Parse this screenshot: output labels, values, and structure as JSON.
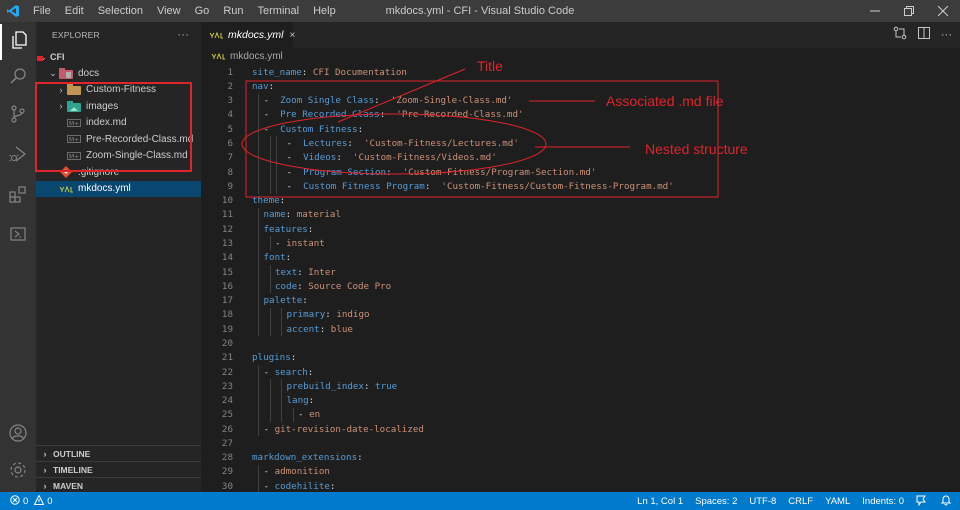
{
  "titlebar": {
    "menu": [
      "File",
      "Edit",
      "Selection",
      "View",
      "Go",
      "Run",
      "Terminal",
      "Help"
    ],
    "title": "mkdocs.yml - CFI - Visual Studio Code"
  },
  "sidebar": {
    "header": "EXPLORER",
    "more": "···",
    "root": "CFI",
    "tree": [
      {
        "label": "docs",
        "type": "folder-open",
        "icon": "docs-folder-icon"
      },
      {
        "label": "Custom-Fitness",
        "type": "folder",
        "icon": "folder-icon"
      },
      {
        "label": "images",
        "type": "folder",
        "icon": "images-folder-icon"
      },
      {
        "label": "index.md",
        "type": "file",
        "icon": "markdown-icon"
      },
      {
        "label": "Pre-Recorded-Class.md",
        "type": "file",
        "icon": "markdown-icon"
      },
      {
        "label": "Zoom-Single-Class.md",
        "type": "file",
        "icon": "markdown-icon"
      },
      {
        "label": ".gitignore",
        "type": "file",
        "icon": "git-icon"
      },
      {
        "label": "mkdocs.yml",
        "type": "file",
        "icon": "yaml-icon",
        "selected": true
      }
    ],
    "sections": [
      "OUTLINE",
      "TIMELINE",
      "MAVEN"
    ]
  },
  "editor": {
    "tab": {
      "label": "mkdocs.yml",
      "close": "×",
      "icon_text": "YML"
    },
    "breadcrumb": "mkdocs.yml",
    "lines": [
      {
        "n": "1",
        "indent": 0,
        "key": "site_name",
        "sep": ": ",
        "val": "CFI Documentation"
      },
      {
        "n": "2",
        "indent": 0,
        "key": "nav",
        "sep": ":",
        "val": ""
      },
      {
        "n": "3",
        "indent": 1,
        "dash": "-  ",
        "key": "Zoom Single Class",
        "sep": ":  ",
        "val": "'Zoom-Single-Class.md'"
      },
      {
        "n": "4",
        "indent": 1,
        "dash": "-  ",
        "key": "Pre Recorded Class",
        "sep": ":  ",
        "val": "'Pre-Recorded-Class.md'"
      },
      {
        "n": "5",
        "indent": 1,
        "dash": "-  ",
        "key": "Custom Fitness",
        "sep": ":",
        "val": ""
      },
      {
        "n": "6",
        "indent": 3,
        "dash": "-  ",
        "key": "Lectures",
        "sep": ":  ",
        "val": "'Custom-Fitness/Lectures.md'"
      },
      {
        "n": "7",
        "indent": 3,
        "dash": "-  ",
        "key": "Videos",
        "sep": ":  ",
        "val": "'Custom-Fitness/Videos.md'"
      },
      {
        "n": "8",
        "indent": 3,
        "dash": "-  ",
        "key": "Program Section",
        "sep": ":  ",
        "val": "'Custom-Fitness/Program-Section.md'"
      },
      {
        "n": "9",
        "indent": 3,
        "dash": "-  ",
        "key": "Custom Fitness Program",
        "sep": ":  ",
        "val": "'Custom-Fitness/Custom-Fitness-Program.md'"
      },
      {
        "n": "10",
        "indent": 0,
        "key": "theme",
        "sep": ":",
        "val": ""
      },
      {
        "n": "11",
        "indent": 1,
        "key": "name",
        "sep": ": ",
        "val": "material"
      },
      {
        "n": "12",
        "indent": 1,
        "key": "features",
        "sep": ":",
        "val": ""
      },
      {
        "n": "13",
        "indent": 2,
        "dash": "- ",
        "key": "",
        "sep": "",
        "val": "instant"
      },
      {
        "n": "14",
        "indent": 1,
        "key": "font",
        "sep": ":",
        "val": ""
      },
      {
        "n": "15",
        "indent": 2,
        "key": "text",
        "sep": ": ",
        "val": "Inter"
      },
      {
        "n": "16",
        "indent": 2,
        "key": "code",
        "sep": ": ",
        "val": "Source Code Pro"
      },
      {
        "n": "17",
        "indent": 1,
        "key": "palette",
        "sep": ":",
        "val": ""
      },
      {
        "n": "18",
        "indent": 3,
        "key": "primary",
        "sep": ": ",
        "val": "indigo"
      },
      {
        "n": "19",
        "indent": 3,
        "key": "accent",
        "sep": ": ",
        "val": "blue"
      },
      {
        "n": "20",
        "indent": 0,
        "key": "",
        "sep": "",
        "val": ""
      },
      {
        "n": "21",
        "indent": 0,
        "key": "plugins",
        "sep": ":",
        "val": ""
      },
      {
        "n": "22",
        "indent": 1,
        "dash": "- ",
        "key": "search",
        "sep": ":",
        "val": ""
      },
      {
        "n": "23",
        "indent": 3,
        "key": "prebuild_index",
        "sep": ": ",
        "val": "true",
        "valkw": true
      },
      {
        "n": "24",
        "indent": 3,
        "key": "lang",
        "sep": ":",
        "val": ""
      },
      {
        "n": "25",
        "indent": 4,
        "dash": "- ",
        "key": "",
        "sep": "",
        "val": "en"
      },
      {
        "n": "26",
        "indent": 1,
        "dash": "- ",
        "key": "",
        "sep": "",
        "val": "git-revision-date-localized"
      },
      {
        "n": "27",
        "indent": 0,
        "key": "",
        "sep": "",
        "val": ""
      },
      {
        "n": "28",
        "indent": 0,
        "key": "markdown_extensions",
        "sep": ":",
        "val": ""
      },
      {
        "n": "29",
        "indent": 1,
        "dash": "- ",
        "key": "",
        "sep": "",
        "val": "admonition"
      },
      {
        "n": "30",
        "indent": 1,
        "dash": "- ",
        "key": "codehilite",
        "sep": ":",
        "val": ""
      }
    ]
  },
  "annotations": {
    "title": "Title",
    "md_file": "Associated .md file",
    "nested": "Nested structure",
    "color": "#e0242b"
  },
  "statusbar": {
    "errors": "0",
    "warnings": "0",
    "position": "Ln 1, Col 1",
    "spaces": "Spaces: 2",
    "encoding": "UTF-8",
    "eol": "CRLF",
    "language": "YAML",
    "indents": "Indents: 0"
  }
}
